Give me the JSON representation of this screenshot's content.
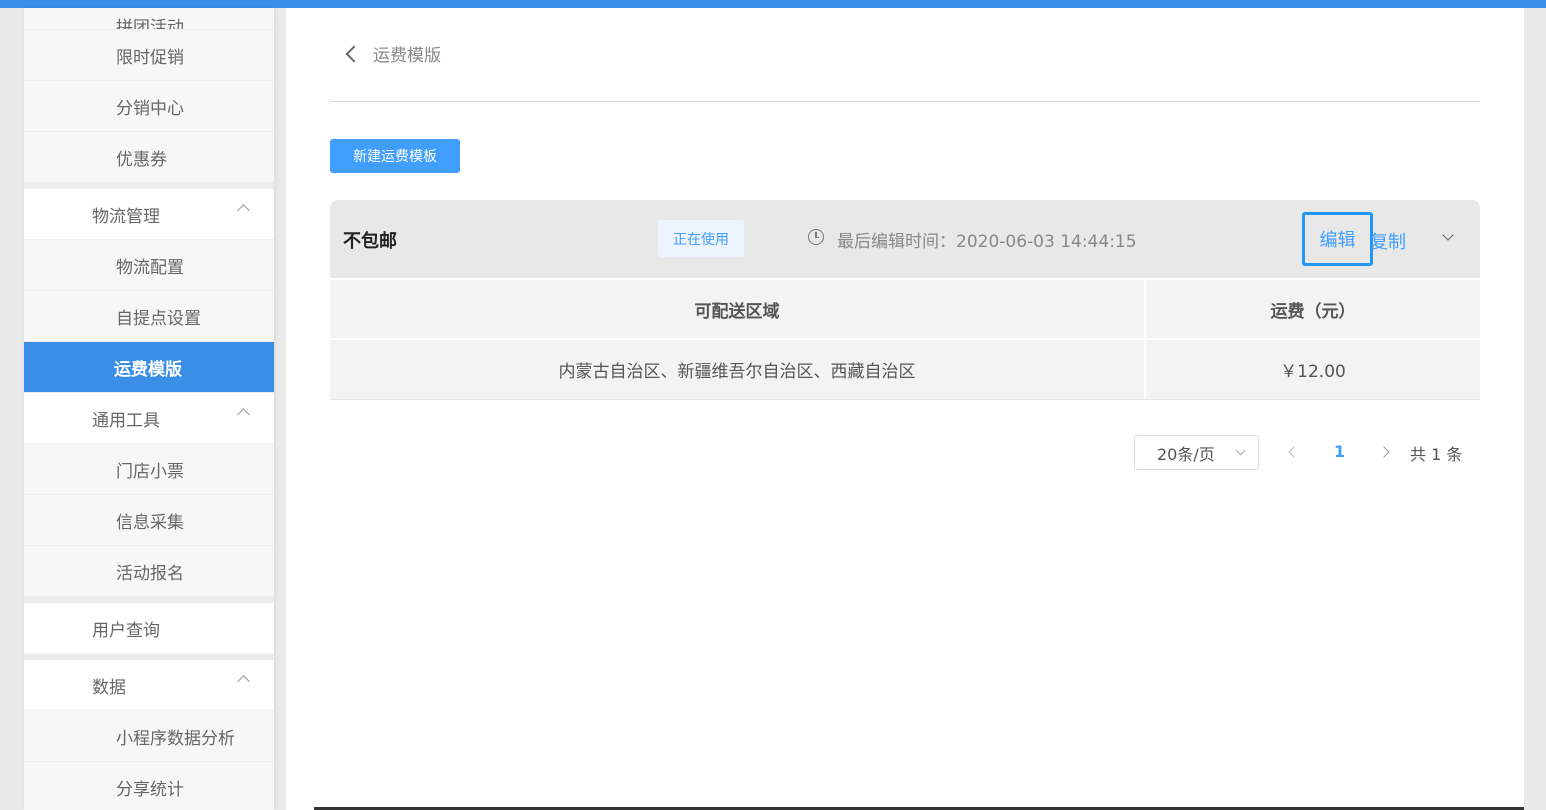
{
  "sidebar": {
    "top_cut": "拼团活动",
    "marketing_items": [
      "限时促销",
      "分销中心",
      "优惠券"
    ],
    "logistics": {
      "label": "物流管理",
      "items": [
        "物流配置",
        "自提点设置",
        "运费模版"
      ]
    },
    "tools": {
      "label": "通用工具",
      "items": [
        "门店小票",
        "信息采集",
        "活动报名"
      ]
    },
    "user_query": "用户查询",
    "data": {
      "label": "数据",
      "items": [
        "小程序数据分析",
        "分享统计"
      ]
    }
  },
  "header": {
    "title": "运费模版"
  },
  "toolbar": {
    "new_button": "新建运费模板"
  },
  "template": {
    "name": "不包邮",
    "status": "正在使用",
    "edit_time_label": "最后编辑时间：",
    "edit_time": "2020-06-03 14:44:15",
    "edit_label": "编辑",
    "copy_label": "复制"
  },
  "table": {
    "headers": [
      "可配送区域",
      "运费（元）"
    ],
    "rows": [
      [
        "内蒙古自治区、新疆维吾尔自治区、西藏自治区",
        "￥12.00"
      ]
    ]
  },
  "pagination": {
    "page_size": "20条/页",
    "current_page": "1",
    "total": "共 1 条"
  },
  "colors": {
    "accent": "#409eff",
    "active_nav": "#3a8ee6"
  },
  "icons": [
    "back-icon",
    "clock-icon",
    "chevron-down-icon",
    "chevron-up-icon",
    "chevron-left-icon",
    "chevron-right-icon"
  ]
}
